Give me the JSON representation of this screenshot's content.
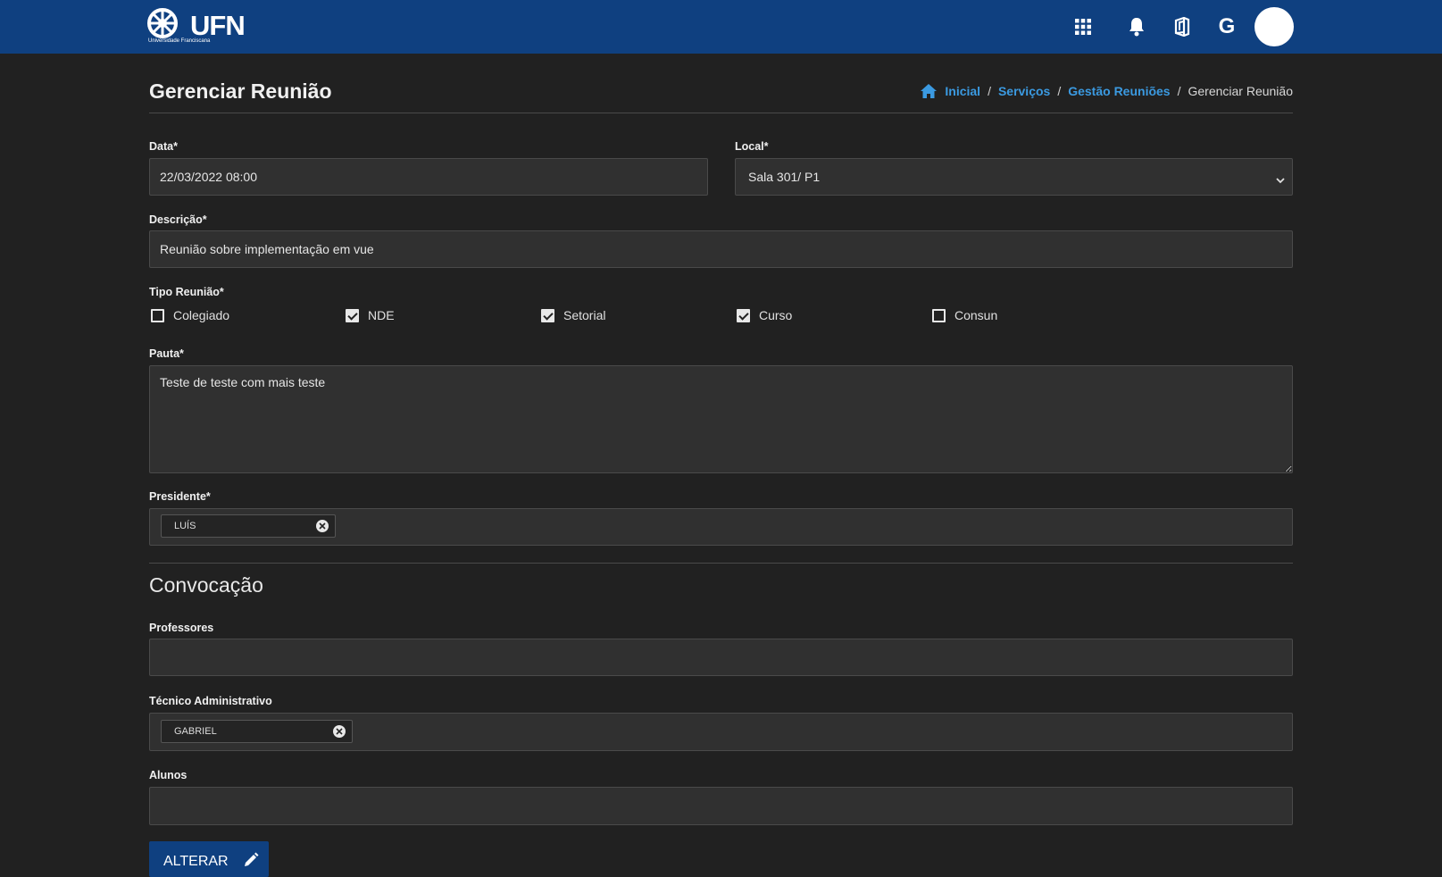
{
  "header": {
    "logo_text": "UFN",
    "logo_subtitle": "Universidade Franciscana",
    "user_initial": "G",
    "icons": [
      "apps-grid-icon",
      "bell-icon",
      "office-icon",
      "avatar"
    ]
  },
  "page": {
    "title": "Gerenciar Reunião",
    "breadcrumb": {
      "home": "Inicial",
      "servicos": "Serviços",
      "gestao": "Gestão Reuniões",
      "current": "Gerenciar Reunião",
      "separator": "/"
    }
  },
  "form": {
    "data_label": "Data*",
    "data_value": "22/03/2022 08:00",
    "local_label": "Local*",
    "local_value": "Sala 301/ P1",
    "descricao_label": "Descrição*",
    "descricao_value": "Reunião sobre implementação em vue",
    "tipo_label": "Tipo Reunião*",
    "tipos": [
      {
        "label": "Colegiado",
        "checked": false
      },
      {
        "label": "NDE",
        "checked": true
      },
      {
        "label": "Setorial",
        "checked": true
      },
      {
        "label": "Curso",
        "checked": true
      },
      {
        "label": "Consun",
        "checked": false
      }
    ],
    "pauta_label": "Pauta*",
    "pauta_value": "Teste de teste com mais teste",
    "presidente_label": "Presidente*",
    "presidente_chip": "LUÍS"
  },
  "convocacao": {
    "title": "Convocação",
    "professores_label": "Professores",
    "tecnico_label": "Técnico Administrativo",
    "tecnico_chip": "GABRIEL",
    "alunos_label": "Alunos"
  },
  "actions": {
    "alterar_label": "ALTERAR"
  },
  "colors": {
    "topbar": "#0f4080",
    "background": "#212121",
    "field": "#303030",
    "link": "#3b9ae1"
  }
}
